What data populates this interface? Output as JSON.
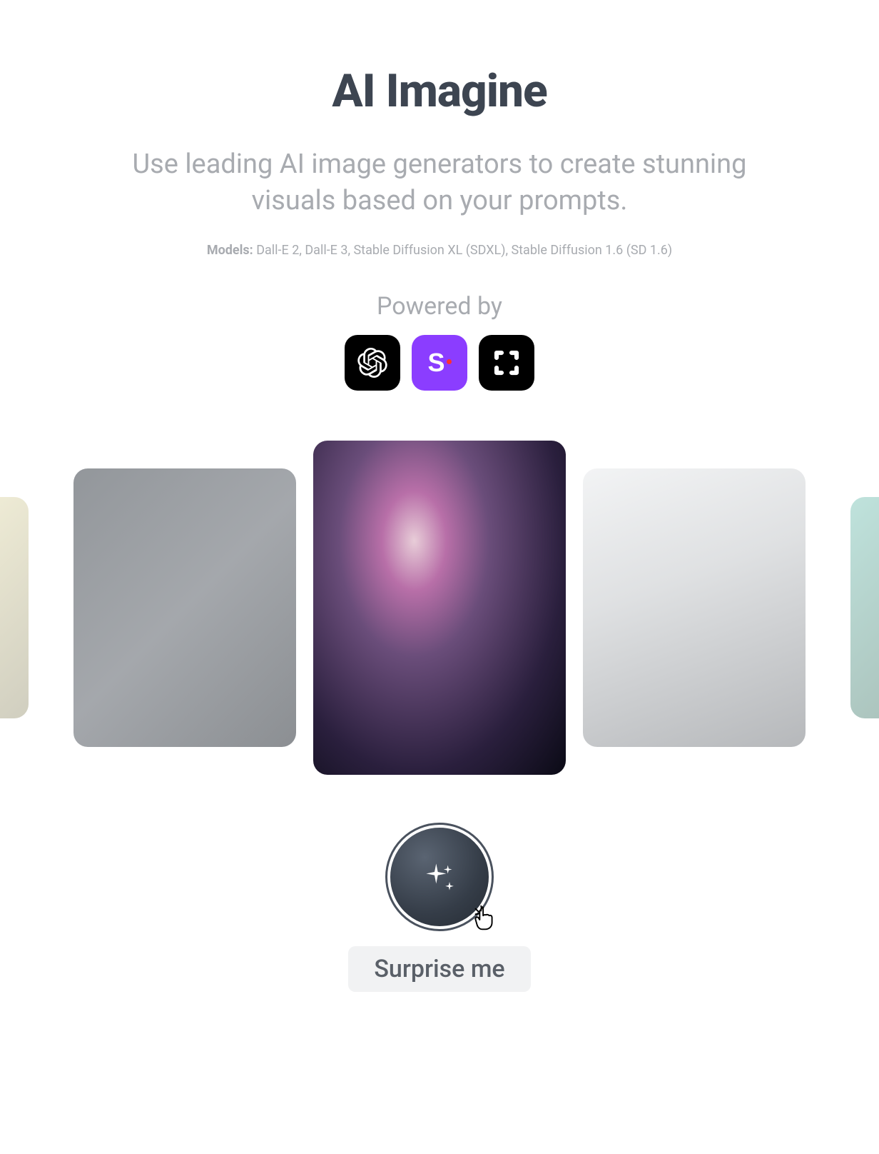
{
  "hero": {
    "title": "AI Imagine",
    "subtitle": "Use leading AI image generators to create stunning visuals based on your prompts."
  },
  "models": {
    "label": "Models:",
    "list": "Dall-E 2, Dall-E 3, Stable Diffusion XL (SDXL), Stable Diffusion 1.6 (SD 1.6)"
  },
  "powered_by": {
    "label": "Powered by",
    "providers": [
      "OpenAI",
      "Stability AI",
      "Third Provider"
    ]
  },
  "carousel": {
    "items": [
      {
        "name": "abstract-left",
        "position": "edge-left"
      },
      {
        "name": "fish",
        "position": "side"
      },
      {
        "name": "einstein-portrait",
        "position": "center"
      },
      {
        "name": "bedroom",
        "position": "side"
      },
      {
        "name": "abstract-right",
        "position": "edge-right"
      }
    ]
  },
  "surprise": {
    "button_label": "Surprise me"
  },
  "stability_glyph": {
    "letter": "S"
  }
}
